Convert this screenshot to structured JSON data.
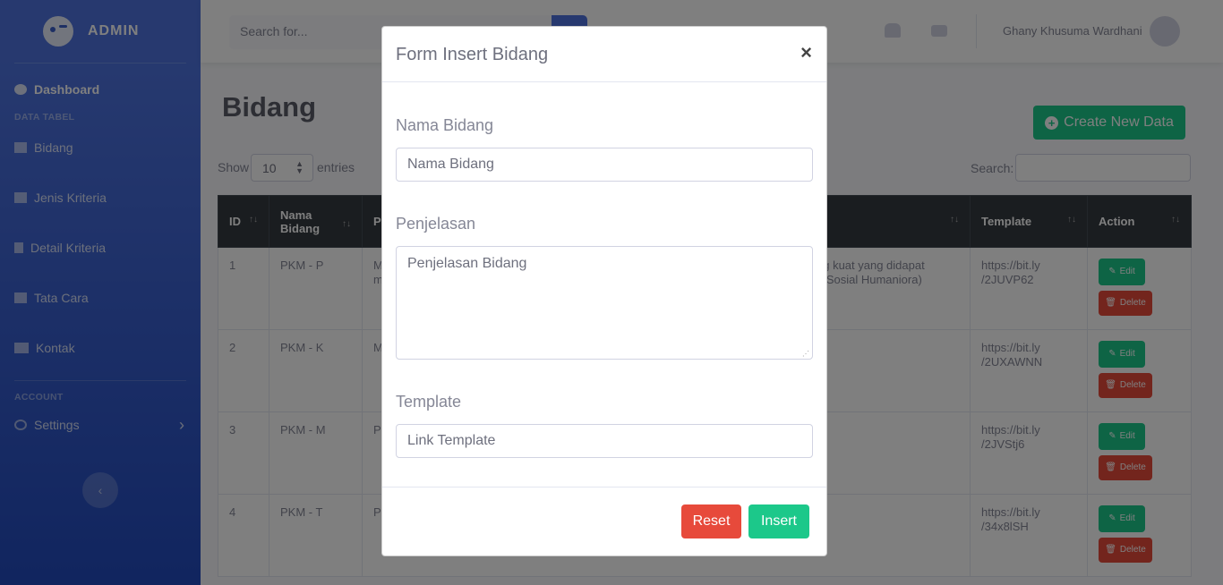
{
  "sidebar": {
    "brand": "ADMIN",
    "dashboard": "Dashboard",
    "section_data": "DATA TABEL",
    "items": [
      "Bidang",
      "Jenis Kriteria",
      "Detail Kriteria",
      "Tata Cara",
      "Kontak"
    ],
    "section_account": "ACCOUNT",
    "settings": "Settings",
    "toggle_icon": "‹",
    "settings_chevron": "›"
  },
  "topbar": {
    "search_placeholder": "Search for...",
    "user_name": "Ghany Khusuma Wardhani"
  },
  "page": {
    "title": "Bidang",
    "create_button": "Create New Data",
    "show_label": "Show",
    "show_value": "10",
    "entries_label": "entries",
    "search_label": "Search:"
  },
  "table": {
    "headers": {
      "id": "ID",
      "nama_line1": "Nama",
      "nama_line2": "Bidang",
      "penjelasan": "P",
      "template": "Template",
      "action": "Action"
    },
    "rows": [
      {
        "id": "1",
        "nama": "PKM - P",
        "pen_left": "M",
        "pen_left2": "m",
        "pen_right1": "ng kuat yang didapat",
        "pen_right2": "n Sosial Humaniora)",
        "template1": "https://bit.ly",
        "template2": "/2JUVP62"
      },
      {
        "id": "2",
        "nama": "PKM - K",
        "pen_left": "M",
        "pen_left2": "",
        "pen_right1": "",
        "pen_right2": "",
        "template1": "https://bit.ly",
        "template2": "/2UXAWNN"
      },
      {
        "id": "3",
        "nama": "PKM - M",
        "pen_left": "P",
        "pen_left2": "",
        "pen_right1": "",
        "pen_right2": "",
        "template1": "https://bit.ly",
        "template2": "/2JVStj6"
      },
      {
        "id": "4",
        "nama": "PKM - T",
        "pen_left": "P",
        "pen_left2": "",
        "pen_right1": "",
        "pen_right2": "",
        "template1": "https://bit.ly",
        "template2": "/34x8lSH"
      }
    ],
    "edit_label": "Edit",
    "delete_label": "Delete",
    "sort_glyph": "↑↓"
  },
  "modal": {
    "title": "Form Insert Bidang",
    "close": "×",
    "nama_label": "Nama Bidang",
    "nama_placeholder": "Nama Bidang",
    "penjelasan_label": "Penjelasan",
    "penjelasan_placeholder": "Penjelasan Bidang",
    "template_label": "Template",
    "template_placeholder": "Link Template",
    "reset": "Reset",
    "insert": "Insert"
  },
  "colors": {
    "primary": "#4e73df",
    "success": "#1cc88a",
    "danger": "#e74a3b",
    "table_head": "#343a40"
  }
}
